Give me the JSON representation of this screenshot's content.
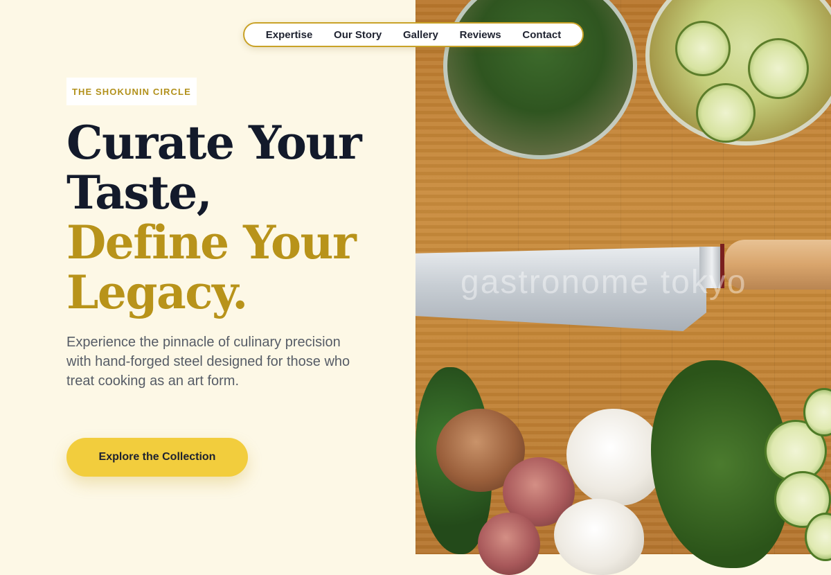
{
  "nav": {
    "items": [
      "Expertise",
      "Our Story",
      "Gallery",
      "Reviews",
      "Contact"
    ]
  },
  "hero": {
    "eyebrow": "THE SHOKUNIN CIRCLE",
    "headline_dark_1": "Curate Your",
    "headline_dark_2": "Taste,",
    "headline_gold_1": "Define Your",
    "headline_gold_2": "Legacy.",
    "description": "Experience the pinnacle of culinary precision with hand-forged steel designed for those who treat cooking as an art form.",
    "cta_label": "Explore the Collection"
  },
  "photo": {
    "watermark": "gastronome tokyo"
  },
  "colors": {
    "background": "#fdf8e6",
    "accent_gold": "#b8931a",
    "cta_yellow": "#f2cd3d",
    "headline_dark": "#131a2b",
    "nav_border": "#c9a227"
  }
}
